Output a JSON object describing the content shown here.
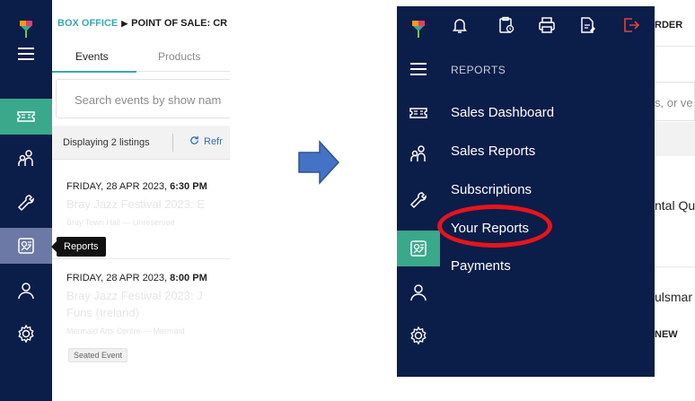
{
  "colors": {
    "sidebar_bg": "#0b1d49",
    "active_green": "#3aa88a",
    "active_blue": "#6c78a6",
    "accent_teal": "#3ba8ad",
    "arrow_blue": "#4472c4",
    "highlight_red": "#e8141b"
  },
  "left_screen": {
    "breadcrumb": {
      "part1": "BOX OFFICE",
      "separator": "▶",
      "part2": "POINT OF SALE: CR"
    },
    "tabs": [
      {
        "label": "Events"
      },
      {
        "label": "Products"
      }
    ],
    "search": {
      "placeholder": "Search events by show nam"
    },
    "listing": {
      "count_text": "Displaying 2 listings",
      "refresh_label": "Refr"
    },
    "events": [
      {
        "date": "FRIDAY, 28 APR 2023, ",
        "time": "6:30 PM",
        "title": "Bray Jazz Festival 2023: E",
        "venue": "Bray Town Hall — Unreserved"
      },
      {
        "date": "FRIDAY, 28 APR 2023, ",
        "time": "8:00 PM",
        "title_line1": "Bray Jazz Festival 2023: J",
        "title_line2": "Funs (Ireland)",
        "venue": "Mermaid Arts Centre — Mermaid",
        "badge": "Seated Event"
      }
    ],
    "tooltip": "Reports",
    "sidebar_icons": [
      "logo-icon",
      "menu-icon",
      "ticket-icon",
      "people-icon",
      "wrench-icon",
      "reports-icon",
      "user-icon",
      "settings-icon"
    ]
  },
  "right_screen": {
    "topbar_icons": [
      "bell-icon",
      "clipboard-icon",
      "printer-icon",
      "scan-icon",
      "logout-icon"
    ],
    "menu": {
      "header": "REPORTS",
      "items": [
        {
          "label": "Sales Dashboard"
        },
        {
          "label": "Sales Reports"
        },
        {
          "label": "Subscriptions"
        },
        {
          "label": "Your Reports"
        },
        {
          "label": "Payments"
        }
      ],
      "highlighted_item": "Your Reports"
    },
    "content_fragments": {
      "order": "RDER",
      "search": "s, or ve",
      "event1_title": "ntal Qu",
      "event2_title": "ulsmar",
      "badge": "NEW"
    }
  }
}
